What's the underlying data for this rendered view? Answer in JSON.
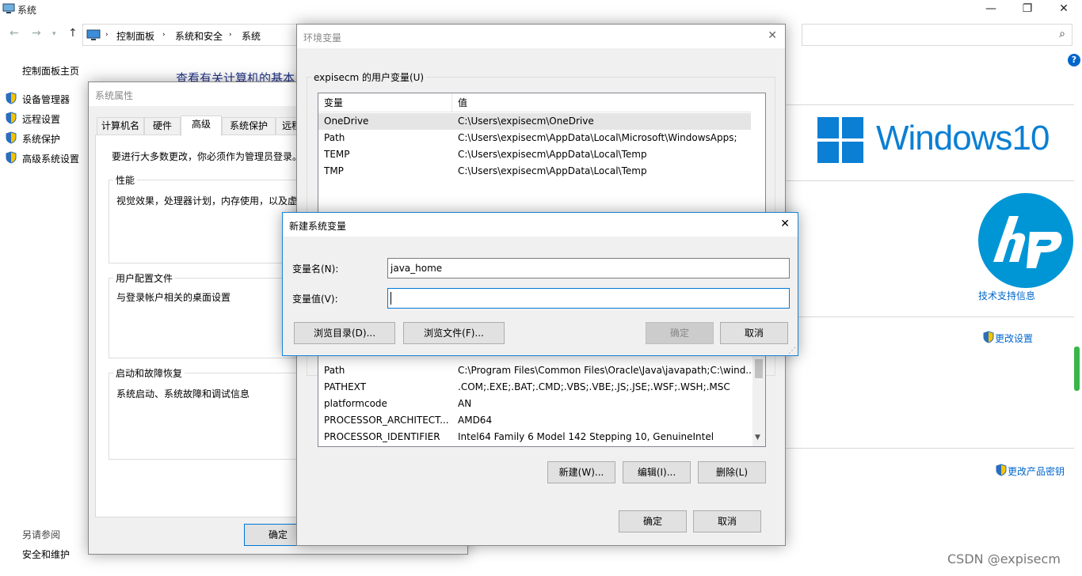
{
  "main": {
    "title": "系统",
    "breadcrumb": [
      "控制面板",
      "系统和安全",
      "系统"
    ],
    "left_nav": {
      "home": "控制面板主页",
      "items": [
        "设备管理器",
        "远程设置",
        "系统保护",
        "高级系统设置"
      ],
      "see_also": "另请参阅",
      "security": "安全和维护"
    },
    "heading": "查看有关计算机的基本",
    "logo_text": "Windows10",
    "support_link": "技术支持信息",
    "change_settings": "更改设置",
    "change_key": "更改产品密钥",
    "watermark": "CSDN @expisecm"
  },
  "sys_props": {
    "title": "系统属性",
    "tabs": [
      "计算机名",
      "硬件",
      "高级",
      "系统保护",
      "远程"
    ],
    "admin_note": "要进行大多数更改，你必须作为管理员登录。",
    "perf": {
      "label": "性能",
      "text": "视觉效果，处理器计划，内存使用，以及虚"
    },
    "profile": {
      "label": "用户配置文件",
      "text": "与登录帐户相关的桌面设置"
    },
    "startup": {
      "label": "启动和故障恢复",
      "text": "系统启动、系统故障和调试信息"
    },
    "ok": "确定"
  },
  "env": {
    "title": "环境变量",
    "user_group": "expisecm 的用户变量(U)",
    "cols": [
      "变量",
      "值"
    ],
    "user_vars": [
      {
        "name": "OneDrive",
        "value": "C:\\Users\\expisecm\\OneDrive"
      },
      {
        "name": "Path",
        "value": "C:\\Users\\expisecm\\AppData\\Local\\Microsoft\\WindowsApps;"
      },
      {
        "name": "TEMP",
        "value": "C:\\Users\\expisecm\\AppData\\Local\\Temp"
      },
      {
        "name": "TMP",
        "value": "C:\\Users\\expisecm\\AppData\\Local\\Temp"
      }
    ],
    "sys_vars": [
      {
        "name": "Path",
        "value": "C:\\Program Files\\Common Files\\Oracle\\Java\\javapath;C:\\wind..."
      },
      {
        "name": "PATHEXT",
        "value": ".COM;.EXE;.BAT;.CMD;.VBS;.VBE;.JS;.JSE;.WSF;.WSH;.MSC"
      },
      {
        "name": "platformcode",
        "value": "AN"
      },
      {
        "name": "PROCESSOR_ARCHITECT...",
        "value": "AMD64"
      },
      {
        "name": "PROCESSOR_IDENTIFIER",
        "value": "Intel64 Family 6 Model 142 Stepping 10, GenuineIntel"
      }
    ],
    "new_btn": "新建(W)...",
    "edit_btn": "编辑(I)...",
    "delete_btn": "删除(L)",
    "ok": "确定",
    "cancel": "取消"
  },
  "newvar": {
    "title": "新建系统变量",
    "name_label": "变量名(N):",
    "name_value": "java_home",
    "value_label": "变量值(V):",
    "value_value": "",
    "browse_dir": "浏览目录(D)...",
    "browse_file": "浏览文件(F)...",
    "ok": "确定",
    "cancel": "取消"
  },
  "colors": {
    "accent": "#0078d7",
    "link": "#0066cc",
    "win_blue": "#0a7fd4",
    "hp_blue": "#0096d6"
  }
}
